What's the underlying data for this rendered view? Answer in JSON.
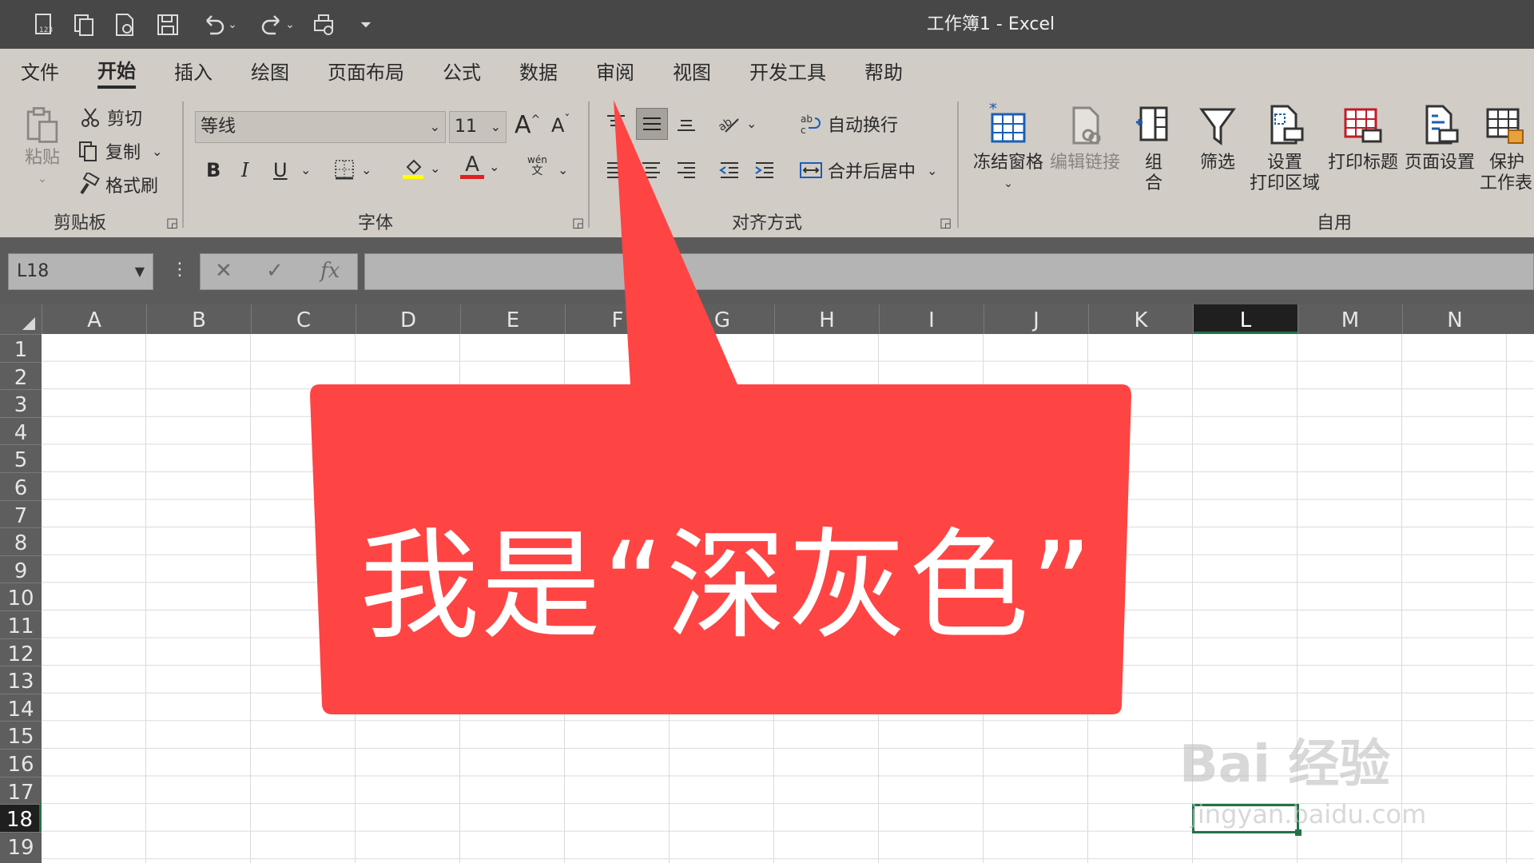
{
  "window": {
    "title": "工作簿1  -  Excel"
  },
  "quick_access": [
    "numbers-icon",
    "copy-doc-icon",
    "new-doc-icon",
    "save-icon",
    "undo-icon",
    "redo-icon",
    "print-preview-icon",
    "customize-icon"
  ],
  "menu": {
    "tabs": [
      "文件",
      "开始",
      "插入",
      "绘图",
      "页面布局",
      "公式",
      "数据",
      "审阅",
      "视图",
      "开发工具",
      "帮助"
    ],
    "active": "开始"
  },
  "ribbon": {
    "clipboard": {
      "paste": "粘贴",
      "cut": "剪切",
      "copy": "复制",
      "format_painter": "格式刷",
      "label": "剪贴板"
    },
    "font": {
      "name": "等线",
      "size": "11",
      "grow": "A",
      "shrink": "A",
      "bold": "B",
      "italic": "I",
      "underline": "U",
      "phonetic_top": "wén",
      "phonetic_bottom": "文",
      "font_color_letter": "A",
      "label": "字体"
    },
    "alignment": {
      "wrap": "自动换行",
      "merge": "合并后居中",
      "label": "对齐方式"
    },
    "custom": {
      "freeze": "冻结窗格",
      "edit_links": "编辑链接",
      "group_top": "组",
      "group_bottom": "合",
      "filter": "筛选",
      "print_area_top": "设置",
      "print_area_bottom": "打印区域",
      "print_titles": "打印标题",
      "page_setup": "页面设置",
      "protect_top": "保护",
      "protect_bottom": "工作表",
      "label": "自用"
    }
  },
  "formula_bar": {
    "name_box": "L18",
    "cancel": "✕",
    "enter": "✓",
    "fx": "fx",
    "value": ""
  },
  "grid": {
    "columns": [
      "A",
      "B",
      "C",
      "D",
      "E",
      "F",
      "G",
      "H",
      "I",
      "J",
      "K",
      "L",
      "M",
      "N"
    ],
    "rows": [
      "1",
      "2",
      "3",
      "4",
      "5",
      "6",
      "7",
      "8",
      "9",
      "10",
      "11",
      "12",
      "13",
      "14",
      "15",
      "16",
      "17",
      "18",
      "19"
    ],
    "selected_column": "L",
    "selected_row": "18",
    "active_cell": "L18"
  },
  "callout": {
    "text": "我是“深灰色”",
    "color": "#ff4444"
  },
  "watermark": {
    "line1": "Bai 经验",
    "line2": "jingyan.baidu.com"
  },
  "colors": {
    "title_bar": "#474747",
    "ribbon": "#d1ccc6",
    "header": "#5e5e5e",
    "accent": "#217346"
  }
}
